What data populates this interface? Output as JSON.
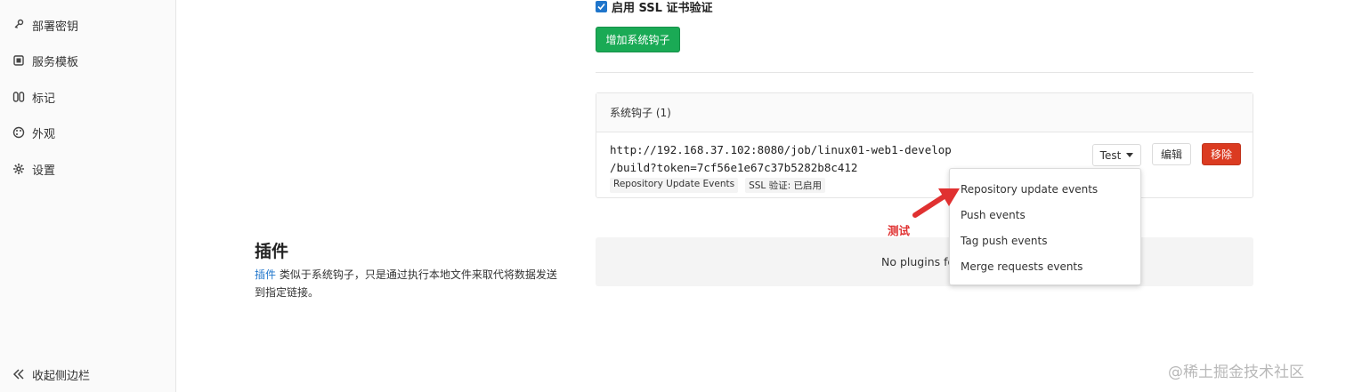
{
  "sidebar": {
    "items": [
      {
        "label": "部署密钥",
        "icon": "key-icon"
      },
      {
        "label": "服务模板",
        "icon": "template-icon"
      },
      {
        "label": "标记",
        "icon": "label-icon"
      },
      {
        "label": "外观",
        "icon": "palette-icon"
      },
      {
        "label": "设置",
        "icon": "gear-icon"
      }
    ],
    "collapse_label": "收起侧边栏"
  },
  "ssl": {
    "label": "启用 SSL 证书验证",
    "checked": true
  },
  "add_hook_label": "增加系统钩子",
  "hooks": {
    "header": "系统钩子 (1)",
    "url_line1": "http://192.168.37.102:8080/job/linux01-web1-develop",
    "url_line2": "/build?token=7cf56e1e67c37b5282b8c412",
    "badge_events": "Repository Update Events",
    "badge_ssl": "SSL 验证: 已启用",
    "test_label": "Test",
    "edit_label": "编辑",
    "remove_label": "移除"
  },
  "dropdown": {
    "items": [
      "Repository update events",
      "Push events",
      "Tag push events",
      "Merge requests events"
    ]
  },
  "annotation": "测试",
  "plugins": {
    "title": "插件",
    "desc_link": "插件",
    "desc_text": " 类似于系统钩子，只是通过执行本地文件来取代将数据发送到指定链接。",
    "empty": "No plugins fo"
  },
  "watermark": "@稀土掘金技术社区",
  "colors": {
    "primary_green": "#1aaa55",
    "danger_red": "#db3b21",
    "link_blue": "#1f75cb",
    "annotation_red": "#e03131"
  }
}
